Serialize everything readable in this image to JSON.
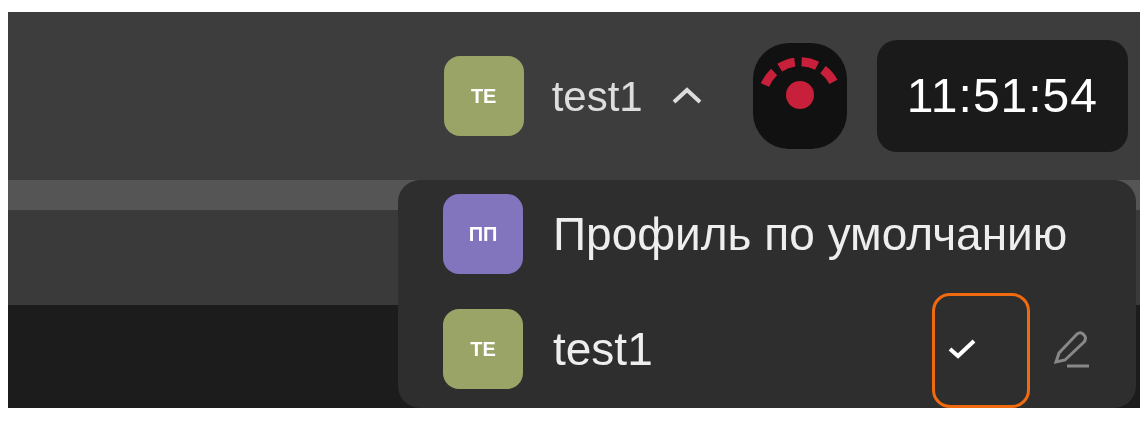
{
  "header": {
    "user": {
      "initials": "TE",
      "name": "test1",
      "color": "#9aa466",
      "expanded": true
    },
    "clock": "11:51:54"
  },
  "profile_menu": {
    "profiles": [
      {
        "initials": "ПП",
        "name": "Профиль по умолчанию",
        "color": "#8274bd",
        "selected": false,
        "highlighted": false
      },
      {
        "initials": "TE",
        "name": "test1",
        "color": "#9aa466",
        "selected": true,
        "highlighted": true
      }
    ]
  }
}
